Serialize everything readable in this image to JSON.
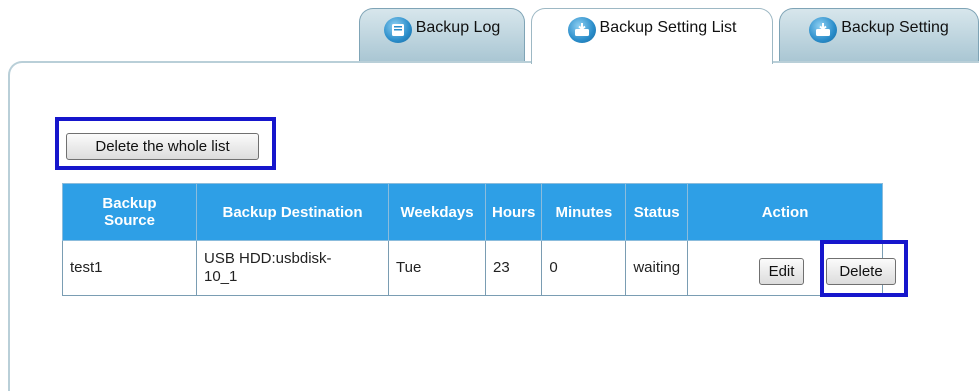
{
  "tabs": [
    {
      "label": "Backup Log",
      "icon": "book-icon",
      "active": false
    },
    {
      "label": "Backup Setting List",
      "icon": "drive-list-icon",
      "active": true
    },
    {
      "label": "Backup Setting",
      "icon": "drive-download-icon",
      "active": false
    }
  ],
  "delete_all_button": "Delete the whole list",
  "table": {
    "headers": [
      "Backup Source",
      "Backup Destination",
      "Weekdays",
      "Hours",
      "Minutes",
      "Status",
      "Action"
    ],
    "rows": [
      {
        "source": "test1",
        "destination": "USB HDD:usbdisk-10_1",
        "weekdays": "Tue",
        "hours": "23",
        "minutes": "0",
        "status": "waiting",
        "edit_label": "Edit",
        "delete_label": "Delete"
      }
    ]
  },
  "colors": {
    "header_blue": "#2e9fe6",
    "highlight": "#1616cc",
    "tab_inactive": "#a9c6d3"
  }
}
